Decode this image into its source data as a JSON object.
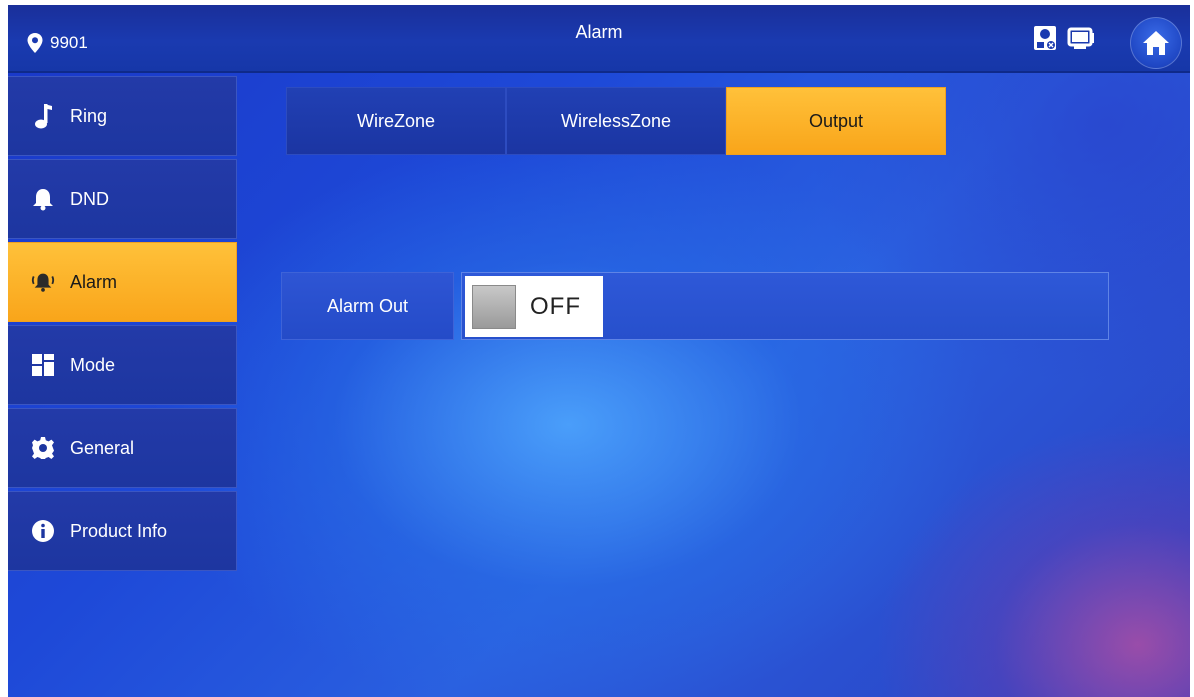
{
  "header": {
    "location_id": "9901",
    "title": "Alarm",
    "icons": [
      "location-pin-icon",
      "card-sd-icon",
      "monitor-icon",
      "home-icon"
    ]
  },
  "sidebar": {
    "items": [
      {
        "label": "Ring",
        "icon": "music-note-icon",
        "active": false
      },
      {
        "label": "DND",
        "icon": "bell-icon",
        "active": false
      },
      {
        "label": "Alarm",
        "icon": "alarm-bell-icon",
        "active": true
      },
      {
        "label": "Mode",
        "icon": "mode-grid-icon",
        "active": false
      },
      {
        "label": "General",
        "icon": "gear-icon",
        "active": false
      },
      {
        "label": "Product Info",
        "icon": "info-icon",
        "active": false
      }
    ]
  },
  "tabs": [
    {
      "label": "WireZone",
      "active": false
    },
    {
      "label": "WirelessZone",
      "active": false
    },
    {
      "label": "Output",
      "active": true
    }
  ],
  "output": {
    "alarm_out_label": "Alarm Out",
    "alarm_out_state": "OFF"
  },
  "colors": {
    "active": "#f9a51a",
    "bar": "#1a3ab0",
    "background": "#1e49d8"
  }
}
